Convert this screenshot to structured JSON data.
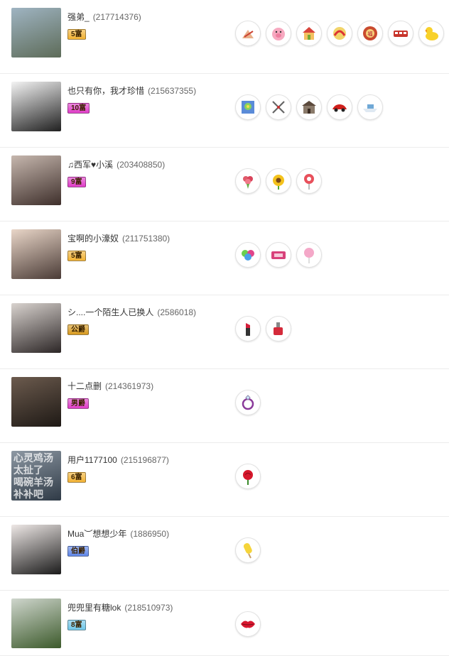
{
  "users": [
    {
      "name": "强弟_",
      "uid": "(217714376)",
      "badge": "5富",
      "badge_color": "#f2b233",
      "avatar_colors": [
        "#9fb4c2",
        "#5d6b58"
      ],
      "gifts": [
        "hands-icon",
        "pig-icon",
        "house-gift-icon",
        "dragon-icon",
        "drum-icon",
        "bus-icon",
        "rubber-duck-icon"
      ]
    },
    {
      "name": "也只有你，我才珍惜",
      "uid": "(215637355)",
      "badge": "10富",
      "badge_color": "#e03cc8",
      "avatar_colors": [
        "#f4f4f4",
        "#202020"
      ],
      "gifts": [
        "fireworks-icon",
        "crossed-swords-icon",
        "mansion-icon",
        "sports-car-icon",
        "yacht-icon"
      ]
    },
    {
      "name": "♫西军♥小溪",
      "uid": "(203408850)",
      "badge": "9富",
      "badge_color": "#e03cc8",
      "avatar_colors": [
        "#c6b7ae",
        "#3e2f2b"
      ],
      "gifts": [
        "bouquet-icon",
        "sunflower-icon",
        "lollipop-icon"
      ]
    },
    {
      "name": "宝啊的小濠奴",
      "uid": "(211751380)",
      "badge": "5富",
      "badge_color": "#f2b233",
      "avatar_colors": [
        "#e9d6c8",
        "#4a3b36"
      ],
      "gifts": [
        "balloons-icon",
        "ticket-icon",
        "cotton-candy-icon"
      ]
    },
    {
      "name": "シ....一个陌生人已换人",
      "uid": "(2586018)",
      "badge": "公爵",
      "badge_color": "#d89a1e",
      "avatar_colors": [
        "#d9d3cf",
        "#2c2626"
      ],
      "gifts": [
        "lipstick-icon",
        "nail-polish-icon"
      ]
    },
    {
      "name": "十二点删",
      "uid": "(214361973)",
      "badge": "男爵",
      "badge_color": "#e03cc8",
      "avatar_colors": [
        "#6c5b4e",
        "#1e1915"
      ],
      "gifts": [
        "ring-icon"
      ]
    },
    {
      "name": "用户1177100",
      "uid": "(215196877)",
      "badge": "6富",
      "badge_color": "#f2b233",
      "avatar_colors": [
        "#8d98a3",
        "#2f3a46"
      ],
      "avatar_text": [
        "心灵鸡汤",
        "太扯了",
        "喝碗羊汤",
        "补补吧"
      ],
      "gifts": [
        "rose-icon"
      ]
    },
    {
      "name": "Mua︶想想少年",
      "uid": "(1886950)",
      "badge": "伯爵",
      "badge_color": "#5f86e8",
      "avatar_colors": [
        "#eee8e6",
        "#1b1b1b"
      ],
      "gifts": [
        "popsicle-icon"
      ]
    },
    {
      "name": "兜兜里有糖lok",
      "uid": "(218510973)",
      "badge": "8富",
      "badge_color": "#70c7e8",
      "avatar_colors": [
        "#cfd6cd",
        "#3c5a2b"
      ],
      "gifts": [
        "kiss-lips-icon"
      ]
    }
  ]
}
